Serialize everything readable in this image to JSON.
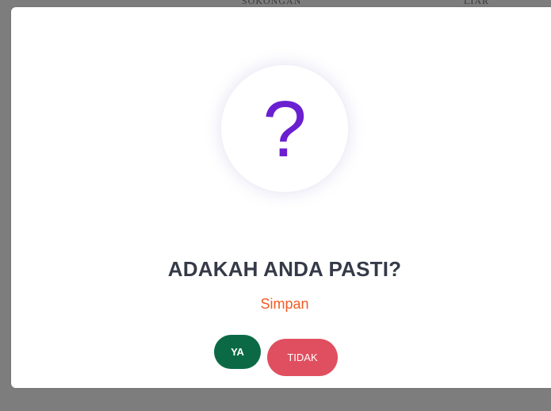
{
  "backdrop": {
    "column_left": "SOKONGAN",
    "column_right": "LIAR"
  },
  "dialog": {
    "icon": "question-mark-icon",
    "icon_glyph": "?",
    "icon_color": "#6a1fd0",
    "title": "ADAKAH ANDA PASTI?",
    "subtitle": "Simpan",
    "subtitle_color": "#f15a24",
    "confirm_label": "YA",
    "confirm_color": "#0b6a45",
    "cancel_label": "TIDAK",
    "cancel_color": "#e04f5f"
  }
}
